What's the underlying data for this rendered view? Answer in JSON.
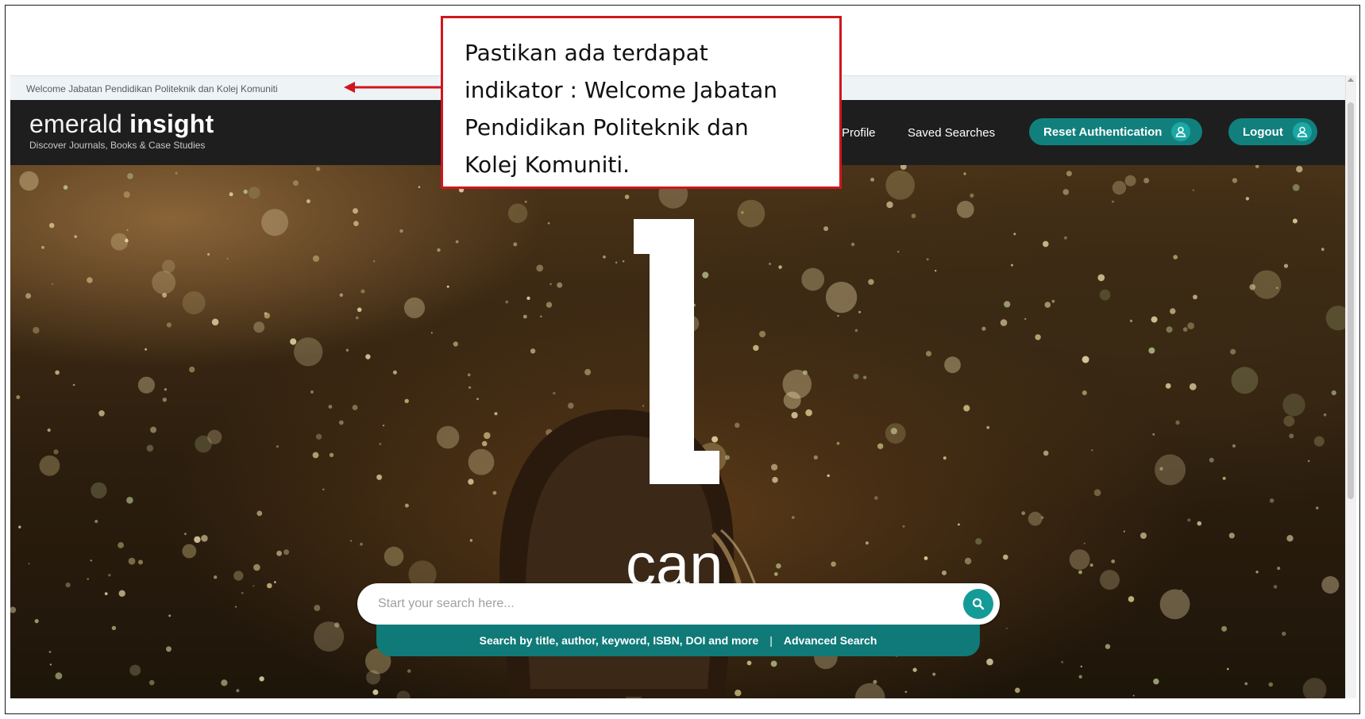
{
  "welcome": {
    "text": "Welcome Jabatan Pendidikan Politeknik dan Kolej Komuniti"
  },
  "header": {
    "logo_light": "emerald",
    "logo_bold": "insight",
    "logo_tagline": "Discover Journals, Books & Case Studies",
    "nav": {
      "profile": "Profile",
      "saved_searches": "Saved Searches",
      "reset_authentication": "Reset Authentication",
      "logout": "Logout"
    },
    "icons": {
      "reset": "user-icon",
      "logout": "user-icon"
    }
  },
  "hero": {
    "big_letter": "i",
    "word": "can"
  },
  "search": {
    "placeholder": "Start your search here...",
    "hint": "Search by title, author, keyword, ISBN, DOI and more",
    "separator": "|",
    "advanced": "Advanced Search",
    "icon": "search-icon"
  },
  "annotation": {
    "line1": "Pastikan ada terdapat",
    "line2": "indikator : Welcome Jabatan",
    "line3": "Pendidikan Politeknik dan",
    "line4": "Kolej Komuniti.",
    "color": "#d0161d"
  },
  "colors": {
    "accent": "#11807d",
    "header_bg": "#1e1e1e",
    "welcome_bar_bg": "#eef3f6"
  }
}
